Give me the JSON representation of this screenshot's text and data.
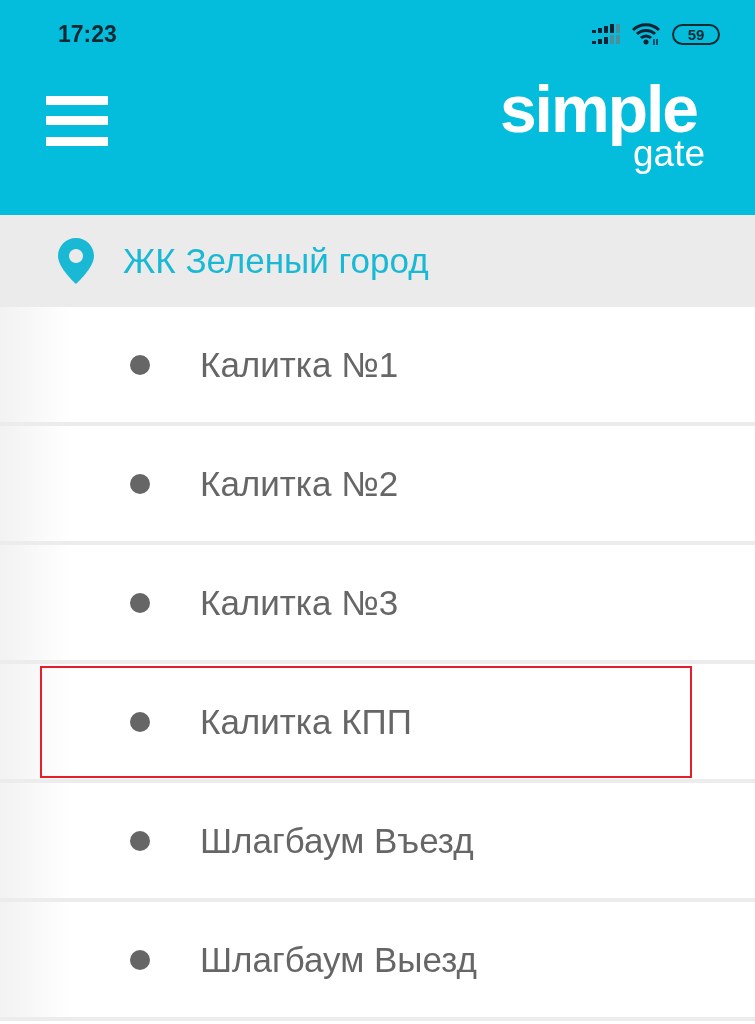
{
  "status_bar": {
    "time": "17:23",
    "battery": "59"
  },
  "header": {
    "logo": {
      "word": "simple",
      "subword": "gate"
    }
  },
  "location": {
    "name": "ЖК Зеленый город"
  },
  "gates": [
    {
      "name": "Калитка №1",
      "highlighted": false
    },
    {
      "name": "Калитка №2",
      "highlighted": false
    },
    {
      "name": "Калитка №3",
      "highlighted": false
    },
    {
      "name": "Калитка КПП",
      "highlighted": true
    },
    {
      "name": "Шлагбаум Въезд",
      "highlighted": false
    },
    {
      "name": "Шлагбаум Выезд",
      "highlighted": false
    }
  ]
}
